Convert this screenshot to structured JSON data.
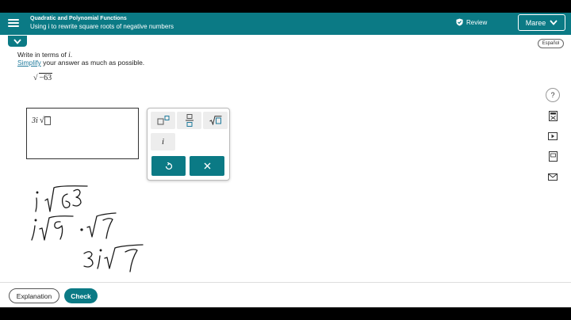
{
  "header": {
    "topic": "Quadratic and Polynomial Functions",
    "lesson": "Using i to rewrite square roots of negative numbers",
    "review_label": "Review",
    "user_name": "Maree"
  },
  "language_toggle": "Español",
  "problem": {
    "prompt_text": "Write in terms of",
    "prompt_var": "i",
    "prompt_end": ".",
    "simplify_link": "Simplify",
    "simplify_rest": "your answer as much as possible.",
    "expression_radicand": "−63"
  },
  "answer": {
    "coefficient": "3",
    "unit": "i"
  },
  "palette": {
    "key_i": "i"
  },
  "scratch_work": [
    "i√63",
    "i√9 · √7",
    "3i√7"
  ],
  "footer": {
    "explanation_label": "Explanation",
    "check_label": "Check"
  },
  "colors": {
    "brand_teal": "#0b7a85",
    "link": "#1f7a9c"
  }
}
